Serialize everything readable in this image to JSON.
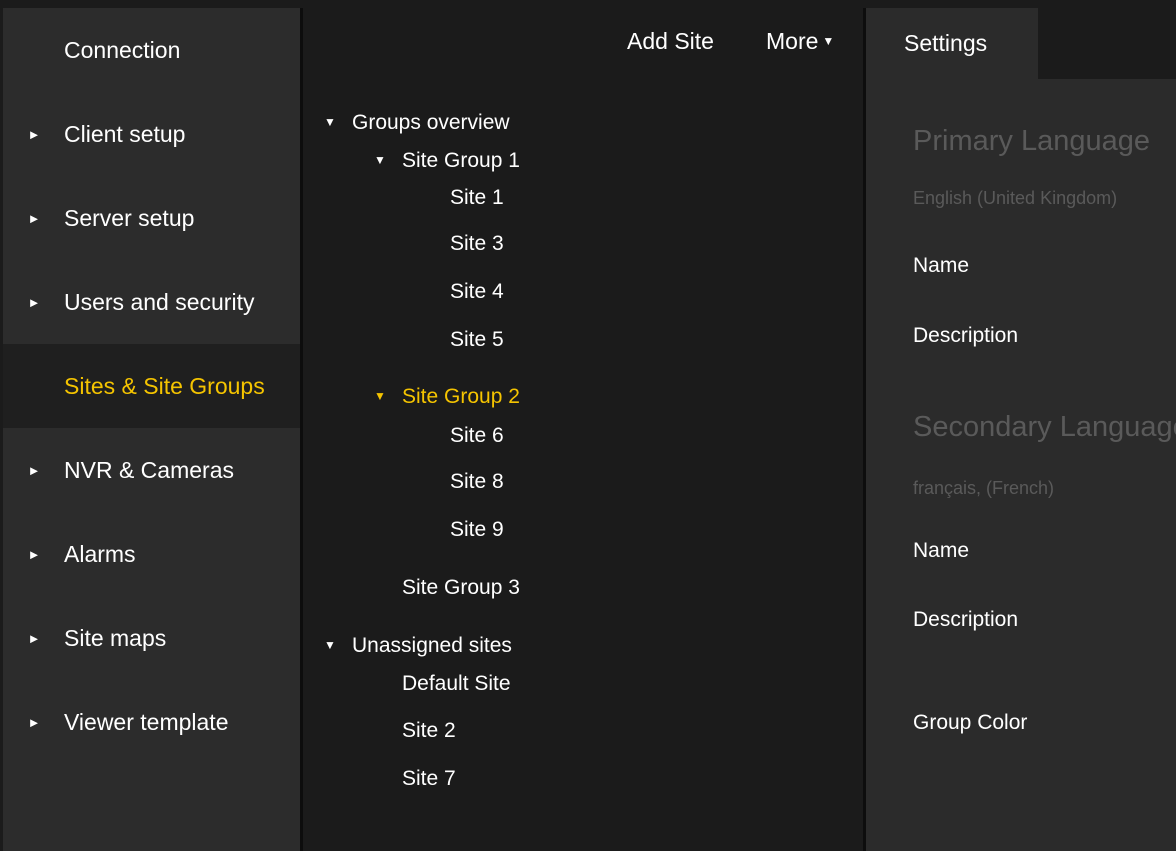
{
  "sidebar": {
    "items": [
      {
        "label": "Connection",
        "arrow": ""
      },
      {
        "label": "Client setup",
        "arrow": "►"
      },
      {
        "label": "Server setup",
        "arrow": "►"
      },
      {
        "label": "Users and security",
        "arrow": "►"
      },
      {
        "label": "Sites & Site Groups",
        "arrow": ""
      },
      {
        "label": "NVR & Cameras",
        "arrow": "►"
      },
      {
        "label": "Alarms",
        "arrow": "►"
      },
      {
        "label": "Site maps",
        "arrow": "►"
      },
      {
        "label": "Viewer template",
        "arrow": "►"
      }
    ],
    "active_index": 4
  },
  "toolbar": {
    "add_site_label": "Add Site",
    "more_label": "More",
    "more_caret": "▼"
  },
  "tree": {
    "groups_overview": {
      "label": "Groups overview",
      "tri": "▼"
    },
    "site_group_1": {
      "label": "Site Group 1",
      "tri": "▼",
      "sites": [
        "Site 1",
        "Site 3",
        "Site 4",
        "Site 5"
      ]
    },
    "site_group_2": {
      "label": "Site Group 2",
      "tri": "▼",
      "sites": [
        "Site 6",
        "Site 8",
        "Site 9"
      ]
    },
    "site_group_3": {
      "label": "Site Group 3"
    },
    "unassigned": {
      "label": "Unassigned sites",
      "tri": "▼",
      "sites": [
        "Default Site",
        "Site 2",
        "Site 7"
      ]
    }
  },
  "settings": {
    "tab_label": "Settings",
    "primary_heading": "Primary Language",
    "primary_language": "English (United Kingdom)",
    "primary_name_label": "Name",
    "primary_description_label": "Description",
    "secondary_heading": "Secondary Language",
    "secondary_language": "français, (French)",
    "secondary_name_label": "Name",
    "secondary_description_label": "Description",
    "group_color_label": "Group Color"
  },
  "colors": {
    "accent": "#f5c400",
    "sidebar_bg": "#2c2c2c",
    "panel_bg": "#1b1b1b",
    "right_bg": "#2b2b2b",
    "muted_text": "#5a5a5a"
  }
}
